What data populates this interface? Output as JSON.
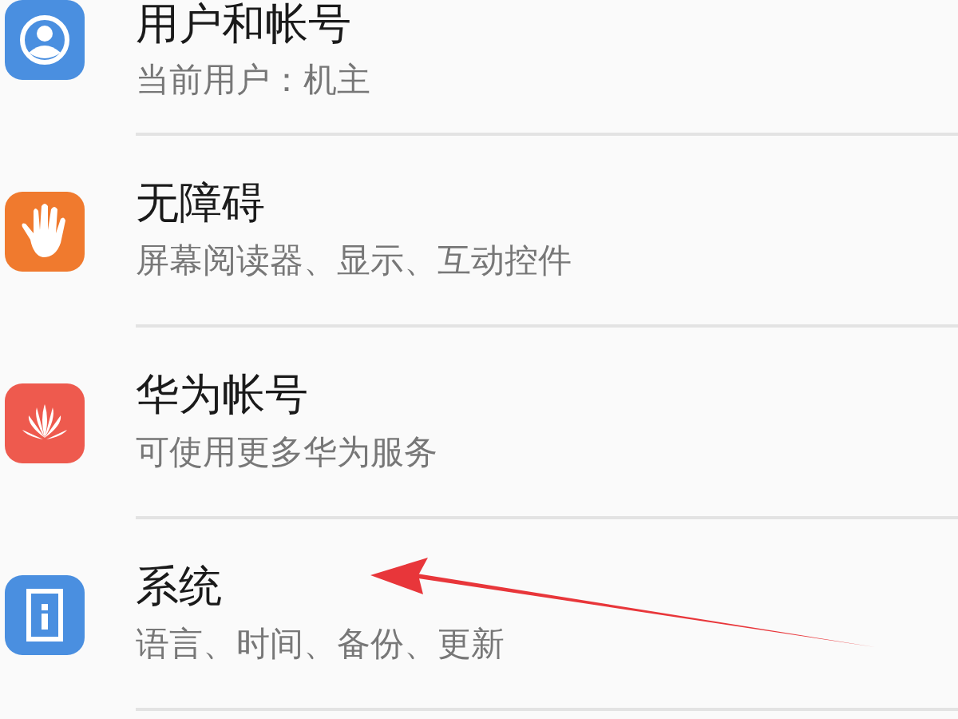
{
  "settings": [
    {
      "kind": "user",
      "color": "#4a8fe0",
      "title": "用户和帐号",
      "subtitle": "当前用户：机主"
    },
    {
      "kind": "hand",
      "color": "#f07a2e",
      "title": "无障碍",
      "subtitle": "屏幕阅读器、显示、互动控件"
    },
    {
      "kind": "fan",
      "color": "#ee5a4e",
      "title": "华为帐号",
      "subtitle": "可使用更多华为服务"
    },
    {
      "kind": "info",
      "color": "#4a8fe0",
      "title": "系统",
      "subtitle": "语言、时间、备份、更新"
    }
  ]
}
